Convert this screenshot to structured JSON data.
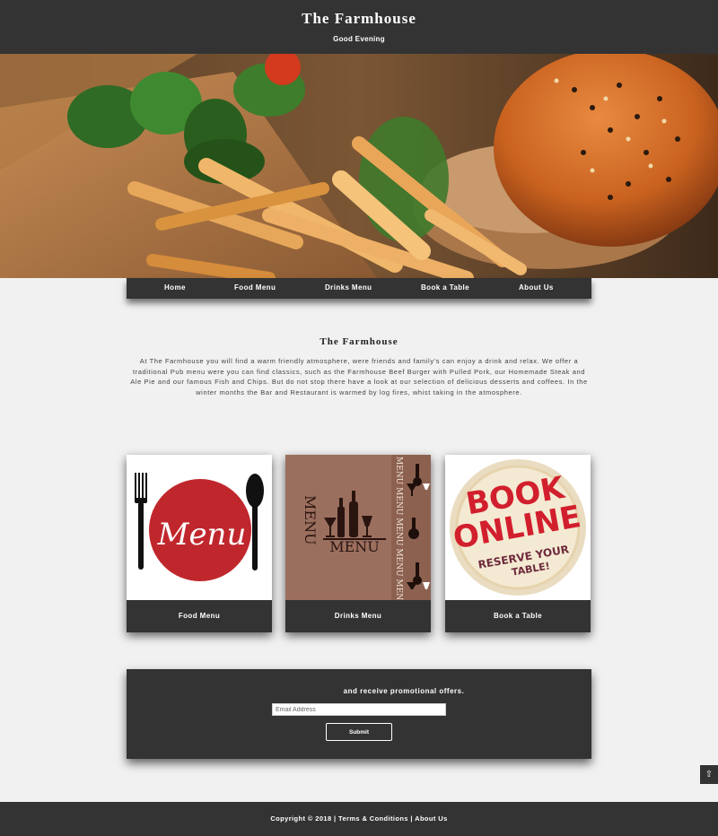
{
  "header": {
    "title": "The Farmhouse",
    "greeting": "Good Evening"
  },
  "nav": {
    "items": [
      {
        "label": "Home"
      },
      {
        "label": "Food Menu"
      },
      {
        "label": "Drinks Menu"
      },
      {
        "label": "Book a Table"
      },
      {
        "label": "About Us"
      }
    ]
  },
  "intro": {
    "title": "The Farmhouse",
    "text": "At The Farmhouse you will find a warm friendly atmosphere, were friends and family's can enjoy a drink and relax. We offer a traditional Pub menu were you can find classics, such as the Farmhouse Beef Burger with Pulled Pork, our Homemade Steak and Ale Pie and our famous Fish and Chips. But do not stop there have a look at our selection of delicious desserts and coffees. In the winter months the Bar and Restaurant is warmed by log fires, whist taking in the atmosphere."
  },
  "cards": [
    {
      "label": "Food Menu",
      "image_text": "Menu"
    },
    {
      "label": "Drinks Menu",
      "image_text": "MENU",
      "side_text": "MENU MENU MENU MENU MENU"
    },
    {
      "label": "Book a Table",
      "image_line1": "BOOK",
      "image_line2": "ONLINE",
      "image_line3": "RESERVE YOUR",
      "image_line4": "TABLE!"
    }
  ],
  "newsletter": {
    "message": "and receive promotional offers.",
    "email_placeholder": "Email Address",
    "submit_label": "Submit"
  },
  "scroll_top": {
    "icon": "arrow-up-icon",
    "glyph": "⇧"
  },
  "footer": {
    "copyright": "Copyright © 2018",
    "separator": "|",
    "terms": "Terms & Conditions",
    "about": "About Us"
  },
  "colors": {
    "dark": "#333333",
    "background": "#f1f1f1",
    "menu_red": "#c0272d",
    "drinks_brown": "#9b6f5e"
  }
}
